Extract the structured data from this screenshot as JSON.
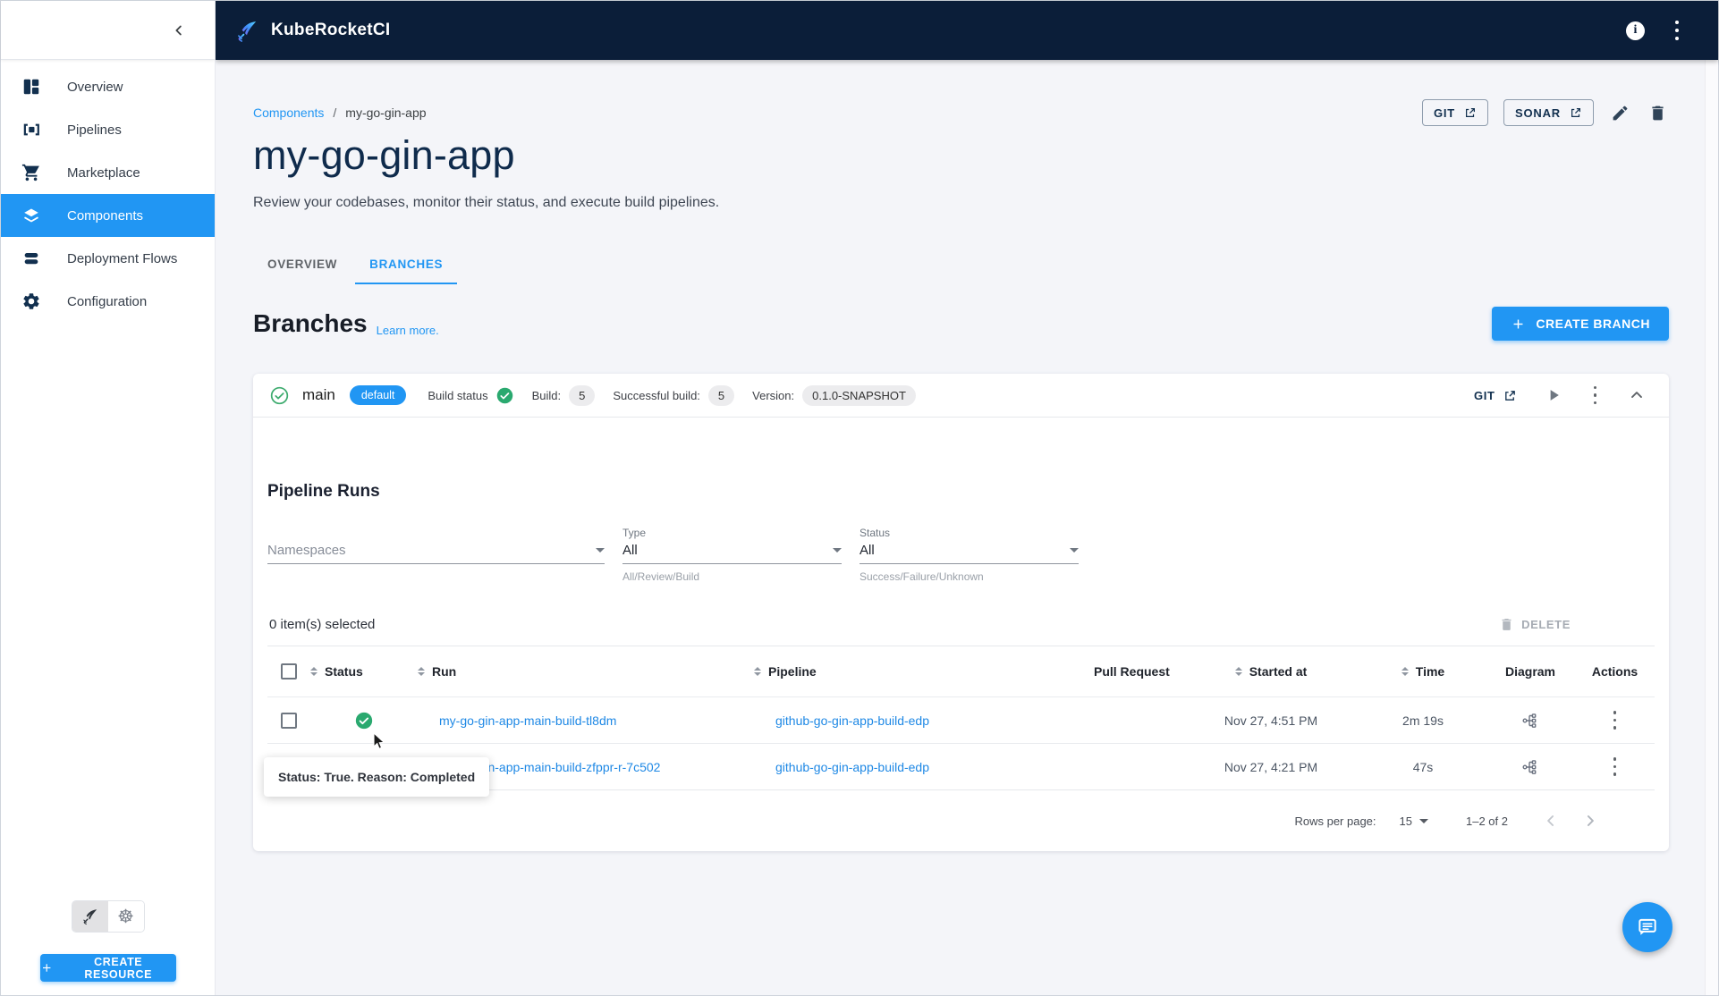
{
  "colors": {
    "accent": "#2196f3",
    "header_bg": "#0b1e39",
    "success_green": "#2aa96f"
  },
  "appbar": {
    "brand": "KubeRocketCI",
    "info_glyph": "i"
  },
  "sidebar": {
    "items": [
      {
        "label": "Overview"
      },
      {
        "label": "Pipelines"
      },
      {
        "label": "Marketplace"
      },
      {
        "label": "Components"
      },
      {
        "label": "Deployment Flows"
      },
      {
        "label": "Configuration"
      }
    ],
    "k8s_glyph": "☸",
    "create_resource": "CREATE RESOURCE"
  },
  "breadcrumb": {
    "root": "Components",
    "sep": "/",
    "current": "my-go-gin-app"
  },
  "page": {
    "title": "my-go-gin-app",
    "subtitle": "Review your codebases, monitor their status, and execute build pipelines.",
    "git": "GIT",
    "sonar": "SONAR"
  },
  "tabs": {
    "overview": "OVERVIEW",
    "branches": "BRANCHES"
  },
  "branches_section": {
    "heading": "Branches",
    "learn_more": "Learn more.",
    "create_branch": "CREATE BRANCH"
  },
  "branch": {
    "name": "main",
    "default_badge": "default",
    "build_status_label": "Build status",
    "build_label": "Build:",
    "build_count": "5",
    "successful_label": "Successful build:",
    "successful_count": "5",
    "version_label": "Version:",
    "version_value": "0.1.0-SNAPSHOT",
    "git": "GIT"
  },
  "runs": {
    "heading": "Pipeline Runs",
    "filters": {
      "namespaces_placeholder": "Namespaces",
      "type_label": "Type",
      "type_value": "All",
      "type_helper": "All/Review/Build",
      "status_label": "Status",
      "status_value": "All",
      "status_helper": "Success/Failure/Unknown"
    },
    "selected": "0 item(s) selected",
    "delete": "DELETE",
    "columns": {
      "status": "Status",
      "run": "Run",
      "pipeline": "Pipeline",
      "pull_request": "Pull Request",
      "started_at": "Started at",
      "time": "Time",
      "diagram": "Diagram",
      "actions": "Actions"
    },
    "rows": [
      {
        "run": "my-go-gin-app-main-build-tl8dm",
        "pipeline": "github-go-gin-app-build-edp",
        "started_at": "Nov 27, 4:51 PM",
        "time": "2m 19s"
      },
      {
        "run": "my-go-gin-app-main-build-zfppr-r-7c502",
        "pipeline": "github-go-gin-app-build-edp",
        "started_at": "Nov 27, 4:21 PM",
        "time": "47s"
      }
    ],
    "tooltip": "Status: True. Reason: Completed",
    "pagination": {
      "label": "Rows per page:",
      "value": "15",
      "range": "1–2 of 2"
    }
  }
}
